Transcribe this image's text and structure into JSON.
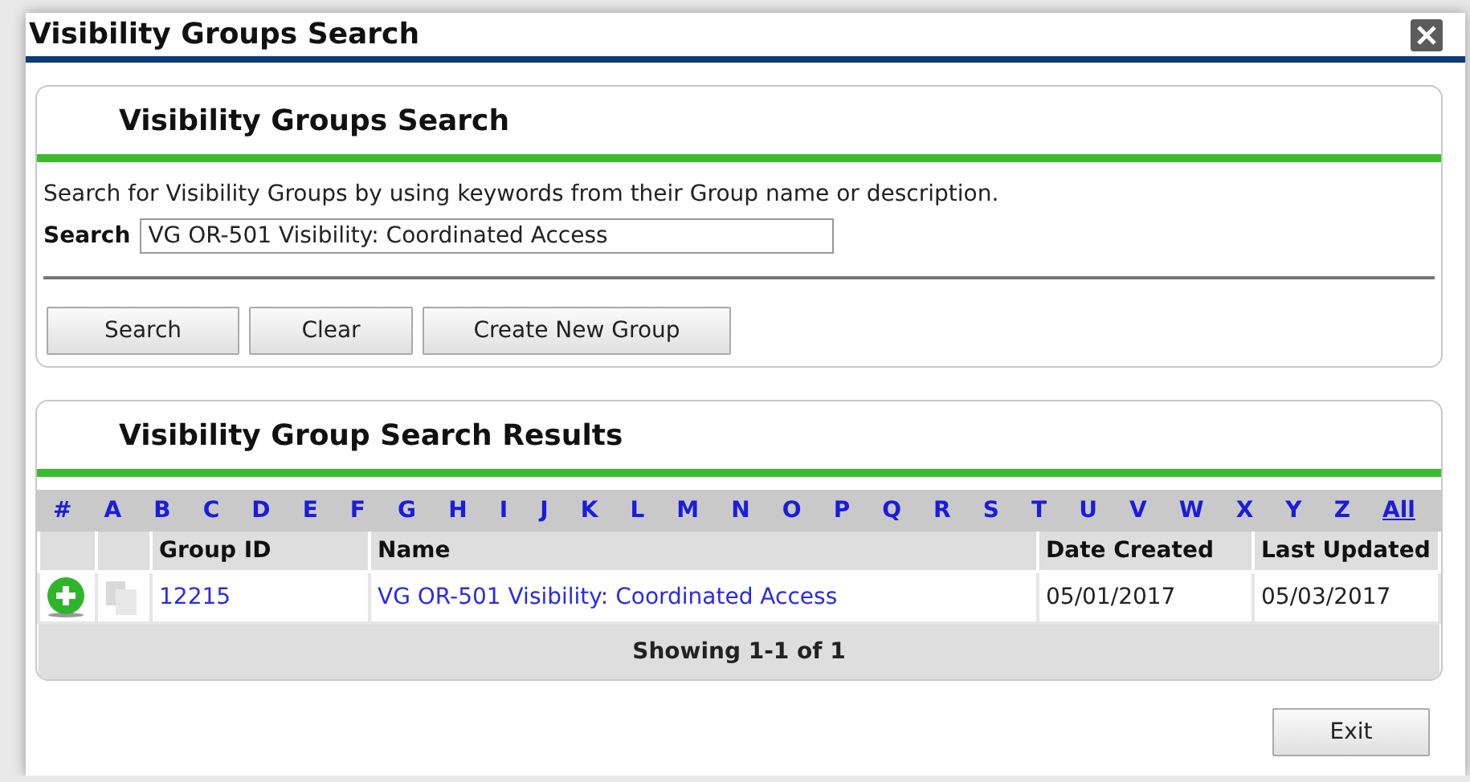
{
  "window": {
    "title": "Visibility Groups Search"
  },
  "search_panel": {
    "title": "Visibility Groups Search",
    "description": "Search for Visibility Groups by using keywords from their Group name or description.",
    "search_label": "Search",
    "search_value": "VG OR-501 Visibility: Coordinated Access",
    "buttons": [
      "Search",
      "Clear",
      "Create New Group"
    ]
  },
  "results_panel": {
    "title": "Visibility Group Search Results",
    "letters": [
      "#",
      "A",
      "B",
      "C",
      "D",
      "E",
      "F",
      "G",
      "H",
      "I",
      "J",
      "K",
      "L",
      "M",
      "N",
      "O",
      "P",
      "Q",
      "R",
      "S",
      "T",
      "U",
      "V",
      "W",
      "X",
      "Y",
      "Z"
    ],
    "all_link": "All",
    "columns": [
      "Group ID",
      "Name",
      "Date Created",
      "Last Updated"
    ],
    "rows": [
      {
        "group_id": "12215",
        "name": "VG OR-501 Visibility: Coordinated Access",
        "date_created": "05/01/2017",
        "last_updated": "05/03/2017"
      }
    ],
    "footer": "Showing 1-1 of 1"
  },
  "buttons": [
    "Exit"
  ]
}
